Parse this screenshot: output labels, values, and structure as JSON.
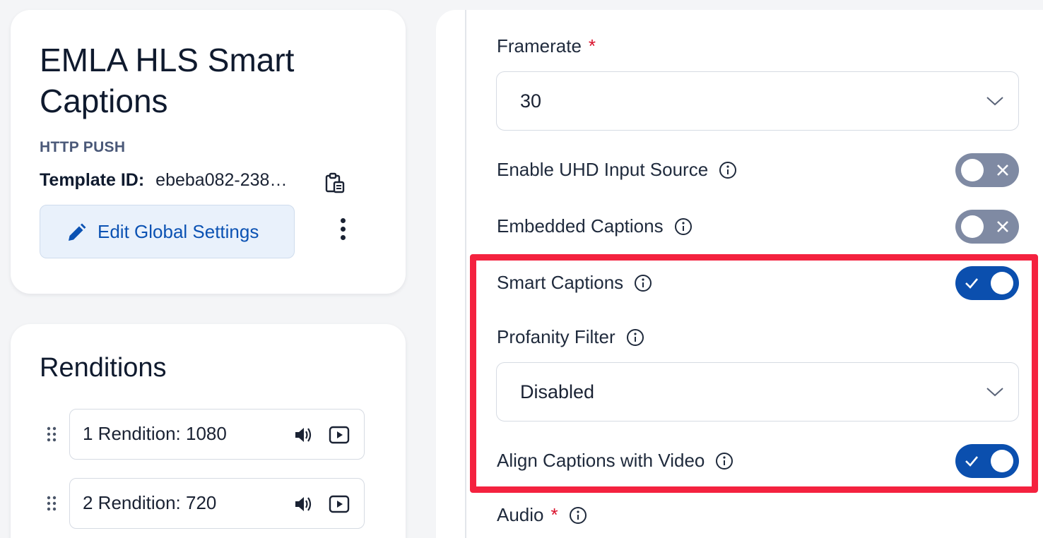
{
  "template": {
    "title": "EMLA HLS Smart Captions",
    "type": "HTTP PUSH",
    "id_label": "Template ID:",
    "id_value": "ebeba082-238…",
    "edit_button_label": "Edit Global Settings",
    "icons": [
      "clipboard-icon",
      "pencil-icon",
      "more-vertical-icon"
    ]
  },
  "renditions": {
    "title": "Renditions",
    "items": [
      {
        "label": "1 Rendition: 1080"
      },
      {
        "label": "2 Rendition: 720"
      }
    ]
  },
  "settings": {
    "framerate": {
      "label": "Framerate",
      "required_mark": "*",
      "value": "30"
    },
    "enable_uhd": {
      "label": "Enable UHD Input Source",
      "enabled": false
    },
    "embedded_captions": {
      "label": "Embedded Captions",
      "enabled": false
    },
    "smart_captions": {
      "label": "Smart Captions",
      "enabled": true
    },
    "profanity_filter": {
      "label": "Profanity Filter",
      "value": "Disabled"
    },
    "align_captions": {
      "label": "Align Captions with Video",
      "enabled": true
    },
    "audio": {
      "label": "Audio",
      "required_mark": "*"
    }
  },
  "colors": {
    "accent": "#0b4fae",
    "toggle_off": "#7f8aa3",
    "highlight": "#f4223f",
    "required": "#d9102a"
  }
}
